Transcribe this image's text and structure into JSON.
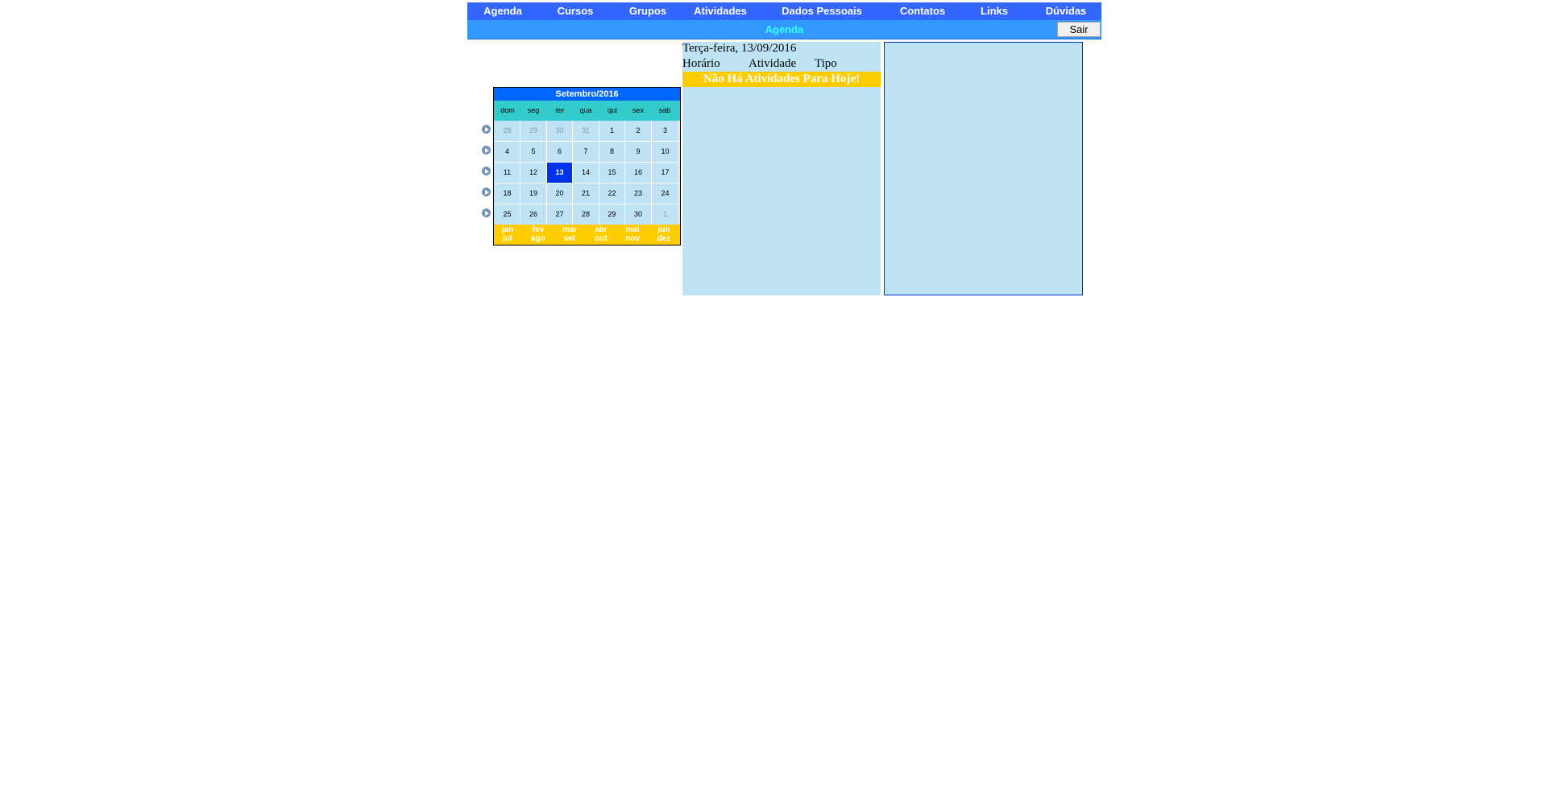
{
  "nav": {
    "items": [
      "Agenda",
      "Cursos",
      "Grupos",
      "Atividades",
      "Dados Pessoais",
      "Contatos",
      "Links",
      "Dúvidas"
    ]
  },
  "subbar": {
    "title": "Agenda",
    "logout_label": "Sair"
  },
  "calendar": {
    "title": "Setembro/2016",
    "weekdays": [
      "dom",
      "seg",
      "ter",
      "qua",
      "qui",
      "sex",
      "sab"
    ],
    "weeks": [
      [
        "28",
        "29",
        "30",
        "31",
        "1",
        "2",
        "3"
      ],
      [
        "4",
        "5",
        "6",
        "7",
        "8",
        "9",
        "10"
      ],
      [
        "11",
        "12",
        "13",
        "14",
        "15",
        "16",
        "17"
      ],
      [
        "18",
        "19",
        "20",
        "21",
        "22",
        "23",
        "24"
      ],
      [
        "25",
        "26",
        "27",
        "28",
        "29",
        "30",
        "1"
      ]
    ],
    "selected_day": "13",
    "months_row1": [
      "jan",
      "fev",
      "mar",
      "abr",
      "mai",
      "jun"
    ],
    "months_row2": [
      "jul",
      "ago",
      "set",
      "out",
      "nov",
      "dez"
    ]
  },
  "day_panel": {
    "date": "Terça-feira, 13/09/2016",
    "col_time": "Horário",
    "col_activity": "Atividade",
    "col_type": "Tipo",
    "empty_message": "Não Há Atividades Para Hoje!"
  },
  "colors": {
    "nav_bg": "#3366ff",
    "subbar_bg": "#3399ff",
    "panel_bg": "#bde3f5",
    "highlight": "#ffcc00",
    "today": "#0033ee"
  }
}
